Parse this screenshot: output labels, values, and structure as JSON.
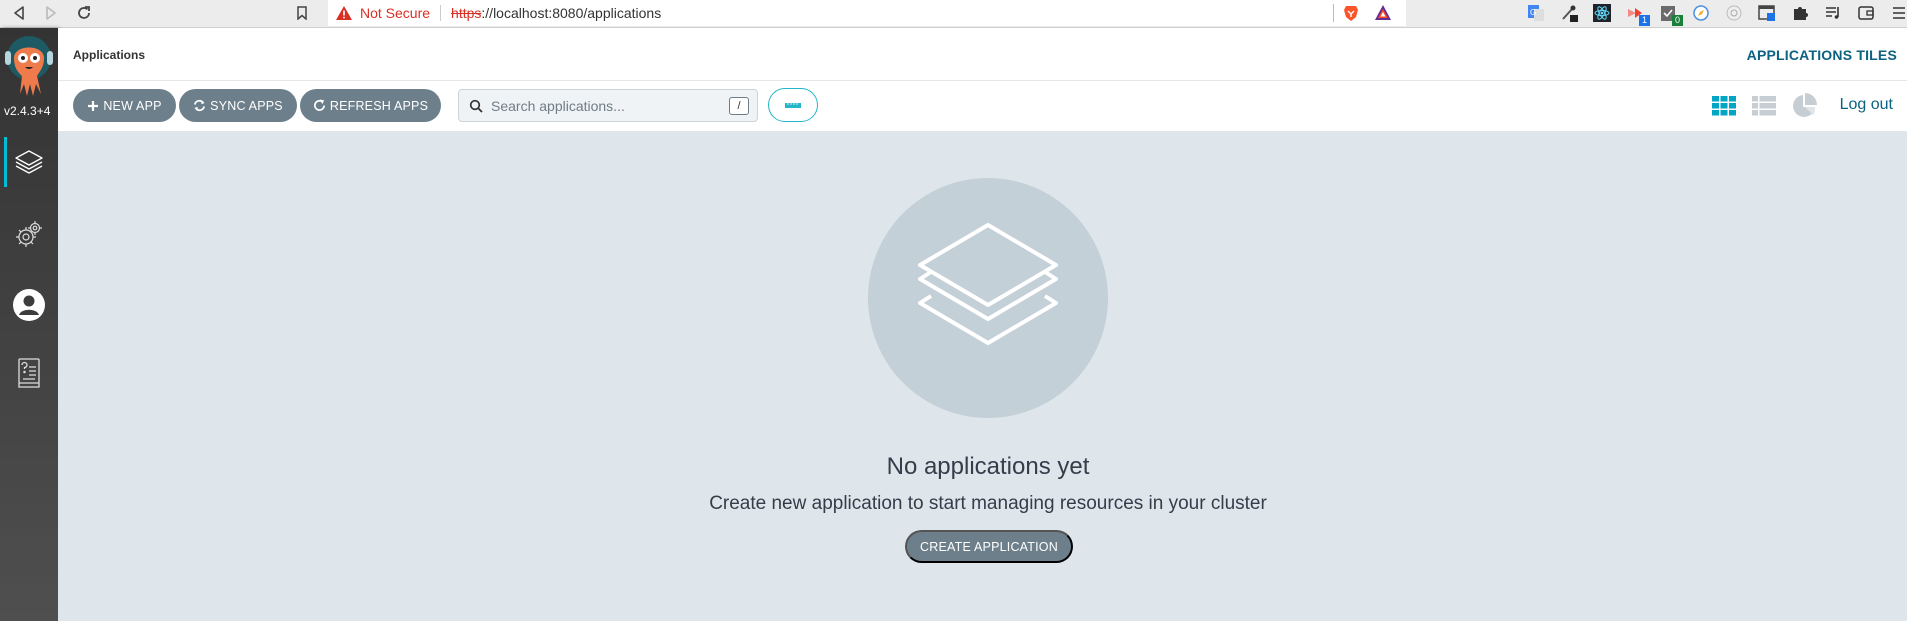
{
  "browser": {
    "security_label": "Not Secure",
    "url_scheme": "https",
    "url_rest": "://localhost:8080/applications",
    "extensions": [
      {
        "name": "google-translate-icon",
        "badge": null
      },
      {
        "name": "eyedropper-icon",
        "badge": null
      },
      {
        "name": "react-devtools-icon",
        "badge": null
      },
      {
        "name": "extension-red-icon",
        "badge": "1",
        "badge_color": "#1a73e8"
      },
      {
        "name": "checklist-icon",
        "badge": "0",
        "badge_color": "#188038"
      },
      {
        "name": "compass-icon",
        "badge": null
      },
      {
        "name": "circle-ext-icon",
        "badge": null
      },
      {
        "name": "screenshot-icon",
        "badge": null
      },
      {
        "name": "puzzle-icon",
        "badge": null
      },
      {
        "name": "media-icon",
        "badge": null
      },
      {
        "name": "wallet-icon",
        "badge": null
      },
      {
        "name": "menu-icon",
        "badge": null
      }
    ]
  },
  "sidebar": {
    "version": "v2.4.3+4",
    "items": [
      {
        "name": "applications",
        "active": true
      },
      {
        "name": "settings",
        "active": false
      },
      {
        "name": "user-info",
        "active": false
      },
      {
        "name": "documentation",
        "active": false
      }
    ]
  },
  "header": {
    "title": "Applications",
    "view_title": "APPLICATIONS TILES"
  },
  "toolbar": {
    "new_app_label": "NEW APP",
    "sync_apps_label": "SYNC APPS",
    "refresh_apps_label": "REFRESH APPS",
    "search_placeholder": "Search applications...",
    "search_value": "",
    "search_shortcut": "/",
    "logout_label": "Log out",
    "active_view": "tiles"
  },
  "empty_state": {
    "title": "No applications yet",
    "subtitle": "Create new application to start managing resources in your cluster",
    "create_label": "CREATE APPLICATION"
  },
  "colors": {
    "accent": "#00bcd4",
    "brand_text": "#0b6281",
    "button_bg": "#6d7f8b",
    "main_bg": "#dee6eb",
    "not_secure": "#d93025"
  }
}
